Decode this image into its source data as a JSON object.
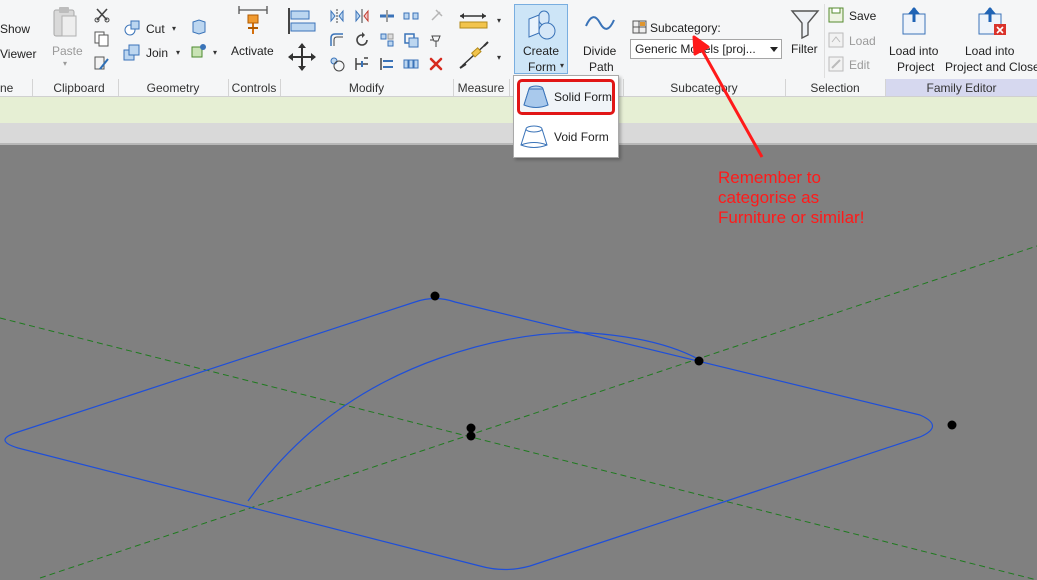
{
  "ribbon": {
    "left_cut": {
      "show_label": "Show",
      "viewer_label": "Viewer",
      "group_label": "ne"
    },
    "clipboard": {
      "paste_label": "Paste",
      "group_label": "Clipboard"
    },
    "geometry": {
      "cut_label": "Cut",
      "join_label": "Join",
      "group_label": "Geometry"
    },
    "controls": {
      "activate_label": "Activate",
      "group_label": "Controls"
    },
    "modify": {
      "group_label": "Modify"
    },
    "measure": {
      "group_label": "Measure"
    },
    "draw": {
      "create_form_label_1": "Create",
      "create_form_label_2": "Form",
      "divide_path_label_1": "Divide",
      "divide_path_label_2": "Path"
    },
    "subcategory": {
      "label": "Subcategory:",
      "selected_value": "Generic Models [proj...",
      "group_label": "Subcategory"
    },
    "selection": {
      "filter_label": "Filter",
      "save_label": "Save",
      "load_label": "Load",
      "edit_label": "Edit",
      "group_label": "Selection"
    },
    "family_editor": {
      "load_into_project_1": "Load into",
      "load_into_project_2": "Project",
      "load_close_1": "Load into",
      "load_close_2": "Project and Close",
      "group_label": "Family Editor"
    }
  },
  "dropdown": {
    "solid_form_label": "Solid Form",
    "void_form_label": "Void Form"
  },
  "annotation": {
    "line_1": "Remember to",
    "line_2": "categorise as",
    "line_3": "Furniture or similar!",
    "color": "#ff1a1a"
  },
  "colors": {
    "sketch_line": "#1f4fd8",
    "reference_plane": "#1f7a1f",
    "viewport_bg": "#808080",
    "family_editor_bar": "#d6d8ef"
  }
}
